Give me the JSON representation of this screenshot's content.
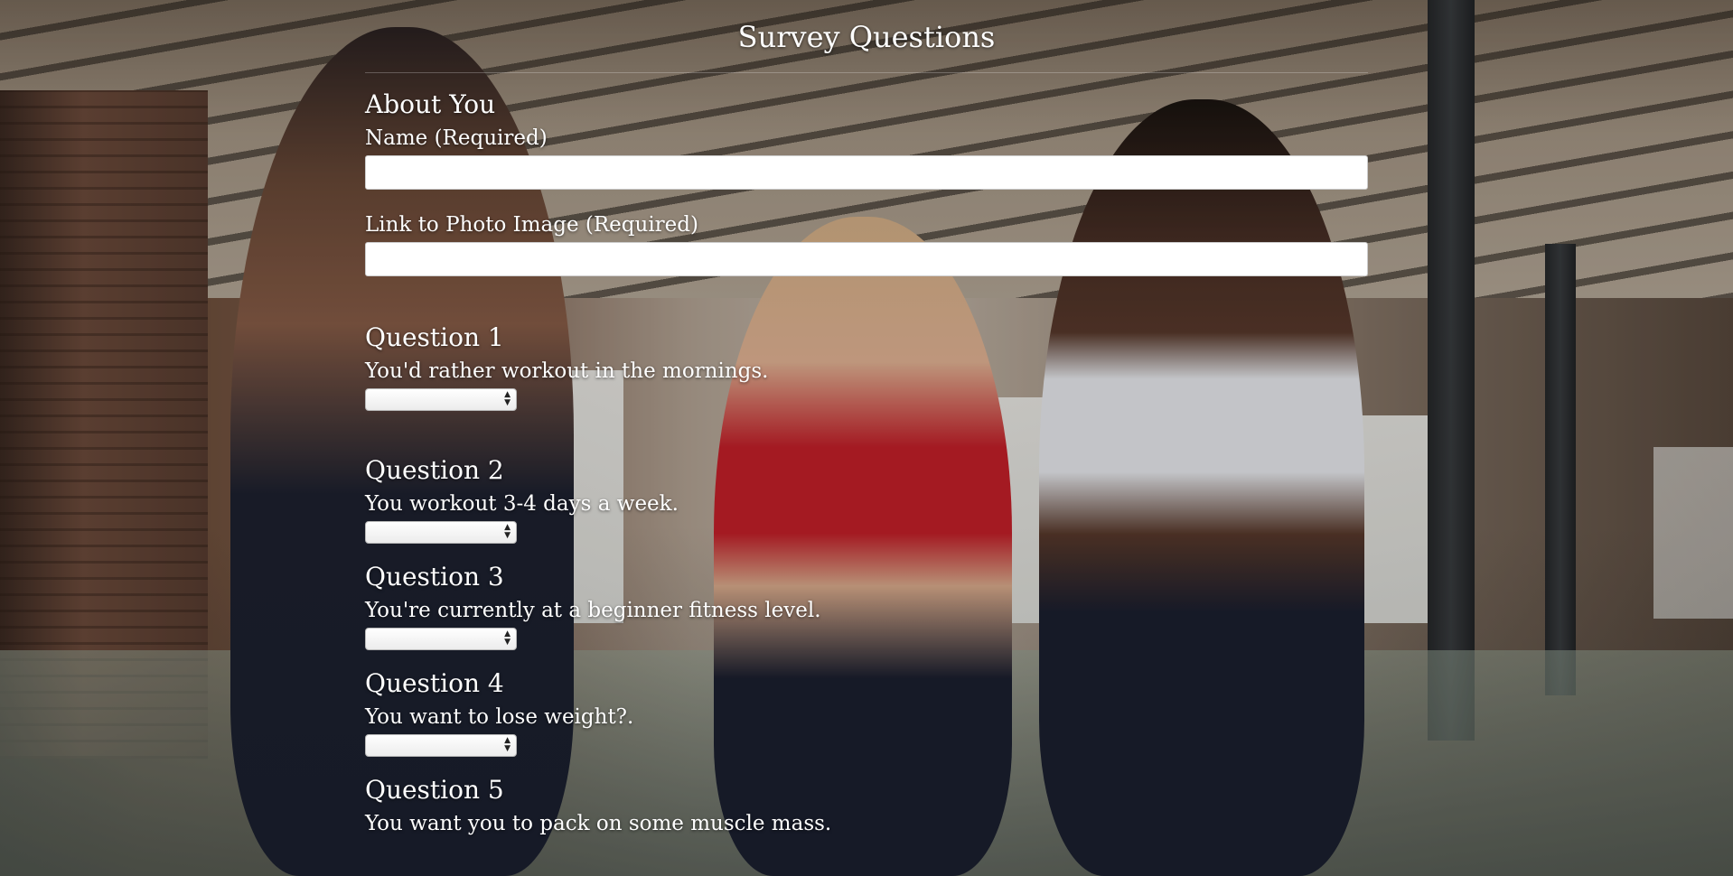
{
  "page": {
    "title": "Survey Questions"
  },
  "about": {
    "heading": "About You",
    "name_label": "Name (Required)",
    "name_value": "",
    "photo_label": "Link to Photo Image (Required)",
    "photo_value": ""
  },
  "questions": [
    {
      "heading": "Question 1",
      "text": "You'd rather workout in the mornings.",
      "selected": ""
    },
    {
      "heading": "Question 2",
      "text": "You workout 3-4 days a week.",
      "selected": ""
    },
    {
      "heading": "Question 3",
      "text": "You're currently at a beginner fitness level.",
      "selected": ""
    },
    {
      "heading": "Question 4",
      "text": "You want to lose weight?.",
      "selected": ""
    },
    {
      "heading": "Question 5",
      "text": "You want you to pack on some muscle mass.",
      "selected": ""
    }
  ],
  "icons": {
    "select_arrow": "updown-arrows-icon"
  },
  "colors": {
    "text": "#ffffff",
    "input_background": "#ffffff"
  }
}
